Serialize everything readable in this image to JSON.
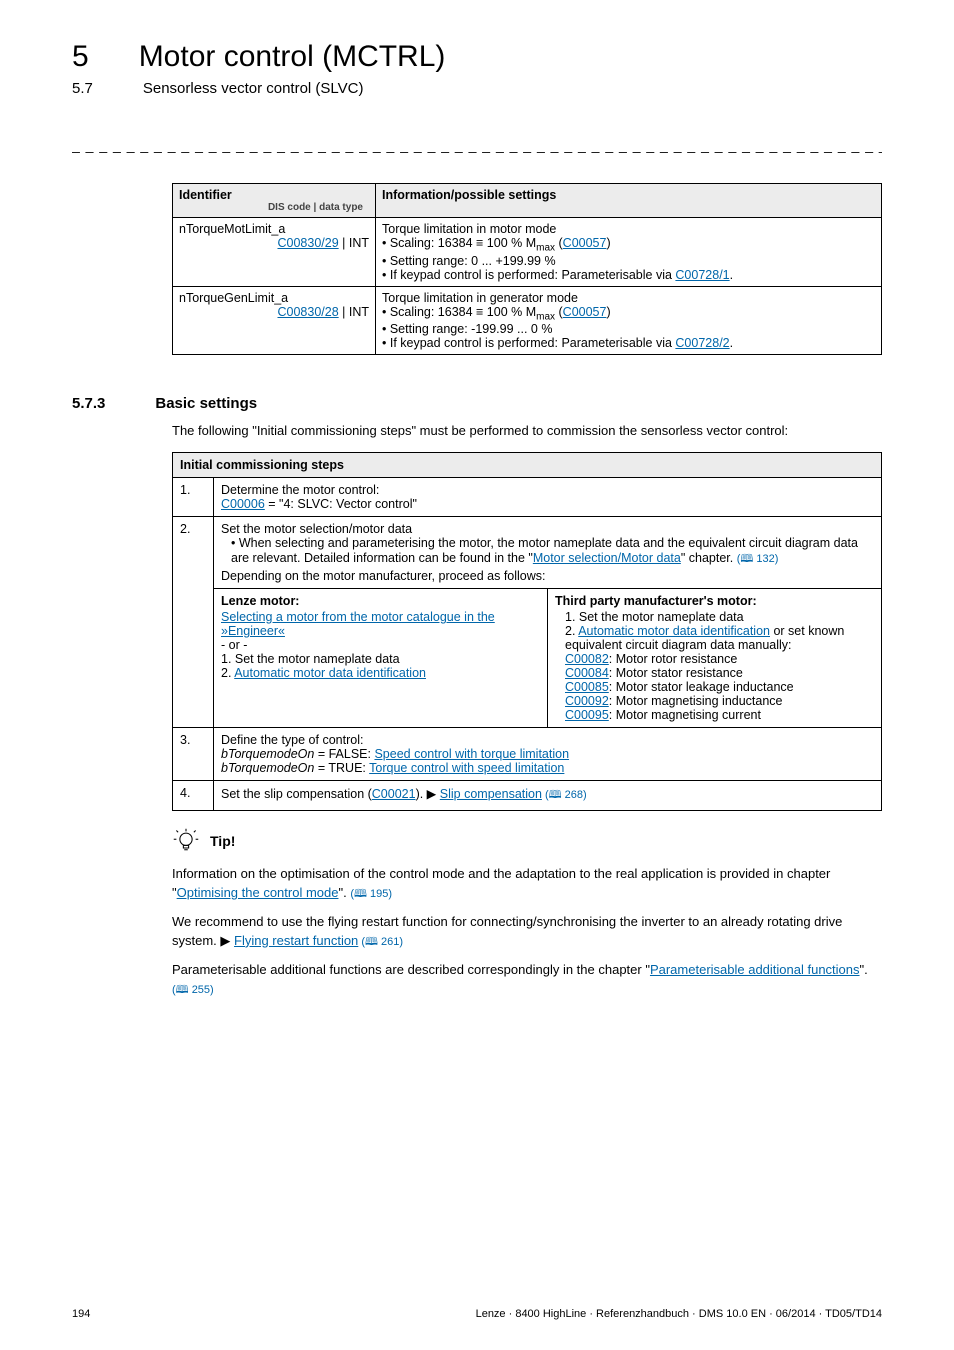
{
  "header": {
    "chapter_number": "5",
    "chapter_title": "Motor control (MCTRL)",
    "section_number": "5.7",
    "section_title": "Sensorless vector control (SLVC)"
  },
  "dashline": "_ _ _ _ _ _ _ _ _ _ _ _ _ _ _ _ _ _ _ _ _ _ _ _ _ _ _ _ _ _ _ _ _ _ _ _ _ _ _ _ _ _ _ _ _ _ _ _ _ _ _ _ _ _ _ _ _ _ _ _ _ _ _ _",
  "table1": {
    "head_left": "Identifier",
    "head_left_sub": "DIS code | data type",
    "head_right": "Information/possible settings",
    "rows": [
      {
        "ident": "nTorqueMotLimit_a",
        "code": "C00830/29",
        "dtype": " | INT",
        "lines": {
          "l0": "Torque limitation in motor mode",
          "l1a": "• Scaling: 16384 ≡ 100 % M",
          "l1sub": "max",
          "l1b": " (",
          "l1link": "C00057",
          "l1c": ")",
          "l2": "• Setting range: 0 ... +199.99 %",
          "l3a": "• If keypad control is performed: Parameterisable via ",
          "l3link": "C00728/1",
          "l3b": "."
        }
      },
      {
        "ident": "nTorqueGenLimit_a",
        "code": "C00830/28",
        "dtype": " | INT",
        "lines": {
          "l0": "Torque limitation in generator mode",
          "l1a": "• Scaling: 16384 ≡ 100 % M",
          "l1sub": "max",
          "l1b": " (",
          "l1link": "C00057",
          "l1c": ")",
          "l2": "• Setting range: -199.99 ... 0 %",
          "l3a": "• If keypad control is performed: Parameterisable via ",
          "l3link": "C00728/2",
          "l3b": "."
        }
      }
    ]
  },
  "section": {
    "num": "5.7.3",
    "title": "Basic settings",
    "intro": "The following \"Initial commissioning steps\" must be performed to commission the sensorless vector control:"
  },
  "steps_table": {
    "header": "Initial commissioning steps",
    "rows": {
      "r1": {
        "num": "1.",
        "line1": "Determine the motor control:",
        "link": "C00006",
        "after_link": " = \"4: SLVC: Vector control\""
      },
      "r2": {
        "num": "2.",
        "line1": "Set the motor selection/motor data",
        "bullet_a": "• When selecting and parameterising the motor, the motor nameplate data and the equivalent circuit diagram data are relevant. Detailed information can be found in the \"",
        "bullet_link": "Motor selection/Motor data",
        "bullet_b": "\" chapter. ",
        "bullet_ref": "(🕮 132)",
        "line2": "Depending on the motor manufacturer, proceed as follows:",
        "left": {
          "head": "Lenze motor:",
          "link1": "Selecting a motor from the motor catalogue in the »Engineer«",
          "or": "- or -",
          "l1": "1. Set the motor nameplate data",
          "l2_pre": "2. ",
          "l2_link": "Automatic motor data identification"
        },
        "right": {
          "head": "Third party manufacturer's motor:",
          "l1": "1. Set the motor nameplate data",
          "l2_pre": "2. ",
          "l2_link": "Automatic motor data identification",
          "l2_post": " or set known equivalent circuit diagram data manually:",
          "items": [
            {
              "code": "C00082",
              "desc": ": Motor rotor resistance"
            },
            {
              "code": "C00084",
              "desc": ": Motor stator resistance"
            },
            {
              "code": "C00085",
              "desc": ": Motor stator leakage inductance"
            },
            {
              "code": "C00092",
              "desc": ": Motor magnetising inductance"
            },
            {
              "code": "C00095",
              "desc": ": Motor magnetising current"
            }
          ]
        }
      },
      "r3": {
        "num": "3.",
        "line1": "Define the type of control:",
        "a_pre": "bTorquemodeOn",
        "a_mid": " = FALSE: ",
        "a_link": "Speed control with torque limitation",
        "b_pre": "bTorquemodeOn",
        "b_mid": " = TRUE: ",
        "b_link": "Torque control with speed limitation"
      },
      "r4": {
        "num": "4.",
        "pre": "Set the slip compensation (",
        "codelink": "C00021",
        "mid": ").  ▶ ",
        "link2": "Slip compensation",
        "ref": " (🕮 268)"
      }
    }
  },
  "tip": {
    "label": "Tip!",
    "p1_a": "Information on the optimisation of the control mode and the adaptation to the real application is provided in chapter \"",
    "p1_link": "Optimising the control mode",
    "p1_b": "\". ",
    "p1_ref": "(🕮 195)",
    "p2_a": "We recommend to use the flying restart function for connecting/synchronising the inverter to an already rotating drive system. ▶ ",
    "p2_link": "Flying restart function",
    "p2_ref": " (🕮 261)",
    "p3_a": "Parameterisable additional functions are described correspondingly in the chapter \"",
    "p3_link": "Parameterisable additional functions",
    "p3_b": "\". ",
    "p3_ref": "(🕮 255)"
  },
  "footer": {
    "page": "194",
    "right": "Lenze · 8400 HighLine · Referenzhandbuch · DMS 10.0 EN · 06/2014 · TD05/TD14"
  }
}
